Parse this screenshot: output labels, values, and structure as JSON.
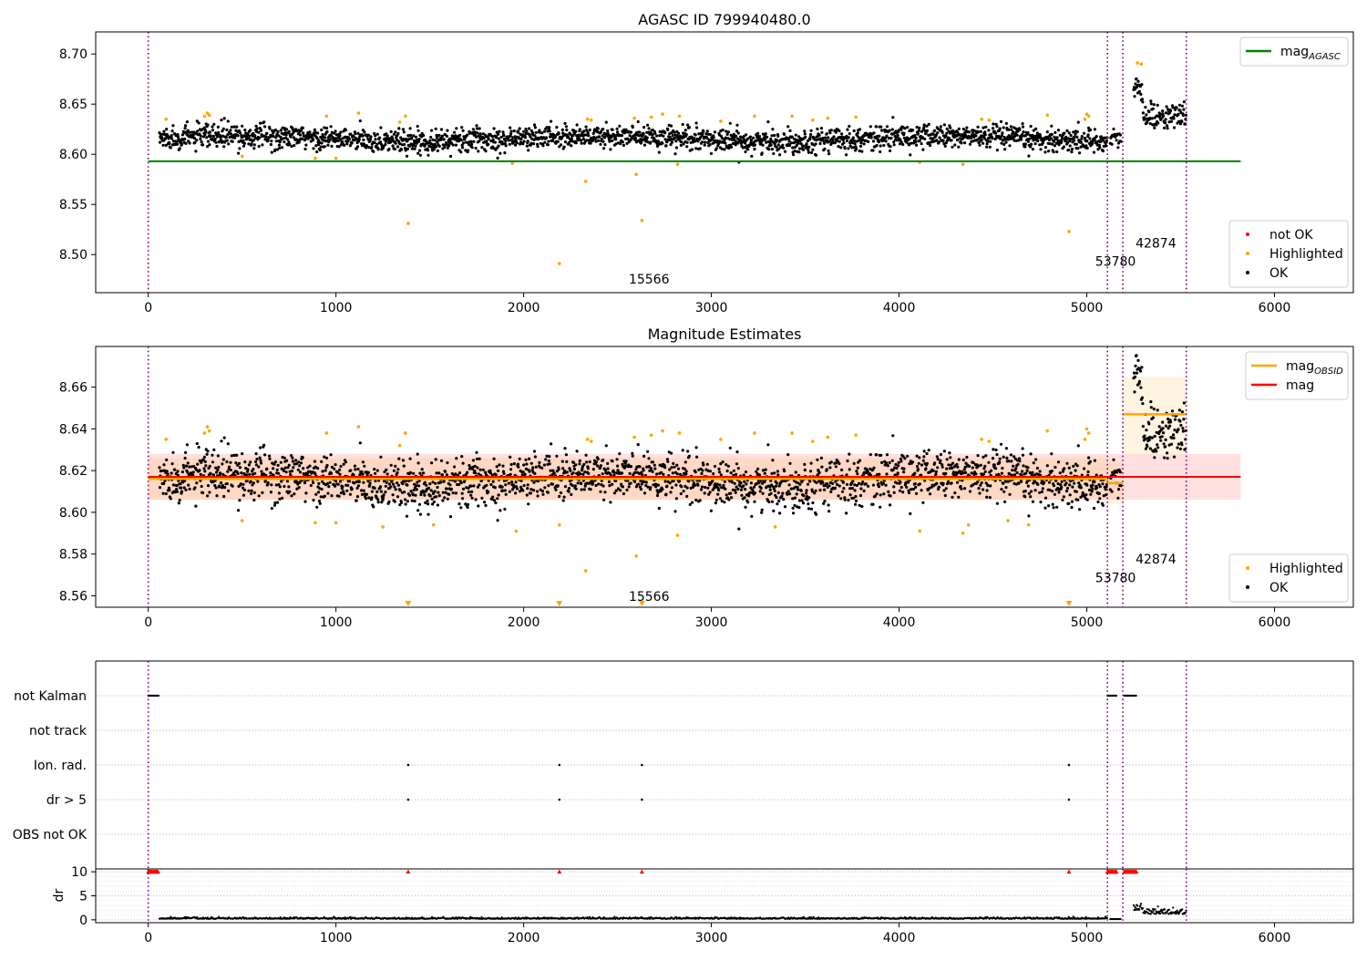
{
  "chart_data": [
    {
      "type": "scatter",
      "title": "AGASC ID 799940480.0",
      "xlim": [
        -280,
        6420
      ],
      "ylim": [
        8.462,
        8.722
      ],
      "xticks": [
        0,
        1000,
        2000,
        3000,
        4000,
        5000,
        6000
      ],
      "xtick_labels": [
        "0",
        "1000",
        "2000",
        "3000",
        "4000",
        "5000",
        "6000"
      ],
      "yticks": [
        8.5,
        8.55,
        8.6,
        8.65,
        8.7
      ],
      "ytick_labels": [
        "8.50",
        "8.55",
        "8.60",
        "8.65",
        "8.70"
      ],
      "grid": false,
      "legends": [
        {
          "placement": "top-right",
          "entries": [
            {
              "label": "mag",
              "sub": "AGASC",
              "color": "#008000",
              "kind": "line"
            }
          ]
        },
        {
          "placement": "bottom-right",
          "entries": [
            {
              "label": "not OK",
              "color": "#ff0000",
              "kind": "dot"
            },
            {
              "label": "Highlighted",
              "color": "#ffa500",
              "kind": "dot"
            },
            {
              "label": "OK",
              "color": "#000000",
              "kind": "dot"
            }
          ]
        }
      ],
      "hlines": [
        {
          "y": 8.593,
          "x0": 0,
          "x1": 5820,
          "color": "#008000"
        }
      ],
      "vlines": [
        0,
        5110,
        5192,
        5530
      ],
      "annotations": [
        {
          "text": "15566",
          "x": 2560,
          "y": 8.471
        },
        {
          "text": "53780",
          "x": 5045,
          "y": 8.489
        },
        {
          "text": "42874",
          "x": 5260,
          "y": 8.507
        }
      ],
      "highlighted": [
        [
          95,
          8.635
        ],
        [
          300,
          8.638
        ],
        [
          315,
          8.641
        ],
        [
          325,
          8.639
        ],
        [
          500,
          8.598
        ],
        [
          890,
          8.596
        ],
        [
          950,
          8.638
        ],
        [
          1000,
          8.596
        ],
        [
          1120,
          8.641
        ],
        [
          1340,
          8.632
        ],
        [
          1370,
          8.638
        ],
        [
          1385,
          8.531
        ],
        [
          1940,
          8.591
        ],
        [
          2190,
          8.491
        ],
        [
          2330,
          8.573
        ],
        [
          2340,
          8.635
        ],
        [
          2360,
          8.634
        ],
        [
          2590,
          8.636
        ],
        [
          2600,
          8.58
        ],
        [
          2630,
          8.534
        ],
        [
          2680,
          8.637
        ],
        [
          2740,
          8.64
        ],
        [
          2820,
          8.59
        ],
        [
          2830,
          8.638
        ],
        [
          3050,
          8.633
        ],
        [
          3230,
          8.638
        ],
        [
          3430,
          8.638
        ],
        [
          3540,
          8.634
        ],
        [
          3620,
          8.636
        ],
        [
          3770,
          8.637
        ],
        [
          4110,
          8.592
        ],
        [
          4340,
          8.59
        ],
        [
          4440,
          8.635
        ],
        [
          4480,
          8.634
        ],
        [
          4790,
          8.639
        ],
        [
          4905,
          8.523
        ],
        [
          4990,
          8.635
        ],
        [
          5000,
          8.64
        ],
        [
          5010,
          8.638
        ],
        [
          5270,
          8.691
        ],
        [
          5290,
          8.69
        ]
      ]
    },
    {
      "type": "scatter",
      "title": "Magnitude Estimates",
      "xlim": [
        -280,
        6420
      ],
      "ylim": [
        8.5545,
        8.6795
      ],
      "xticks": [
        0,
        1000,
        2000,
        3000,
        4000,
        5000,
        6000
      ],
      "xtick_labels": [
        "0",
        "1000",
        "2000",
        "3000",
        "4000",
        "5000",
        "6000"
      ],
      "yticks": [
        8.56,
        8.58,
        8.6,
        8.62,
        8.64,
        8.66
      ],
      "ytick_labels": [
        "8.56",
        "8.58",
        "8.60",
        "8.62",
        "8.64",
        "8.66"
      ],
      "grid": false,
      "legends": [
        {
          "placement": "top-right",
          "entries": [
            {
              "label": "mag",
              "sub": "OBSID",
              "color": "#ffa500",
              "kind": "line"
            },
            {
              "label": "mag",
              "sub": "",
              "color": "#ff0000",
              "kind": "line"
            }
          ]
        },
        {
          "placement": "bottom-right",
          "entries": [
            {
              "label": "Highlighted",
              "color": "#ffa500",
              "kind": "dot"
            },
            {
              "label": "OK",
              "color": "#000000",
              "kind": "dot"
            }
          ]
        }
      ],
      "mag": {
        "value": 8.617,
        "band": [
          8.606,
          8.628
        ],
        "x0": 0,
        "x1": 5820
      },
      "obsid_segments": [
        {
          "x0": 0,
          "x1": 5110,
          "value": 8.616,
          "band": [
            8.606,
            8.626
          ]
        },
        {
          "x0": 5110,
          "x1": 5192,
          "value": 8.614,
          "band": [
            8.604,
            8.624
          ]
        },
        {
          "x0": 5192,
          "x1": 5530,
          "value": 8.647,
          "band": [
            8.628,
            8.665
          ]
        }
      ],
      "vlines": [
        0,
        5110,
        5192,
        5530
      ],
      "annotations": [
        {
          "text": "15566",
          "x": 2560,
          "y": 8.5575
        },
        {
          "text": "53780",
          "x": 5045,
          "y": 8.5665
        },
        {
          "text": "42874",
          "x": 5260,
          "y": 8.5755
        }
      ],
      "offscale_markers": [
        1385,
        2190,
        2630,
        4905
      ],
      "highlighted": [
        [
          95,
          8.635
        ],
        [
          300,
          8.638
        ],
        [
          315,
          8.641
        ],
        [
          325,
          8.639
        ],
        [
          500,
          8.596
        ],
        [
          890,
          8.595
        ],
        [
          950,
          8.638
        ],
        [
          1000,
          8.595
        ],
        [
          1120,
          8.641
        ],
        [
          1250,
          8.593
        ],
        [
          1340,
          8.632
        ],
        [
          1370,
          8.638
        ],
        [
          1520,
          8.594
        ],
        [
          1960,
          8.591
        ],
        [
          2190,
          8.594
        ],
        [
          2330,
          8.572
        ],
        [
          2340,
          8.635
        ],
        [
          2360,
          8.634
        ],
        [
          2590,
          8.636
        ],
        [
          2600,
          8.579
        ],
        [
          2680,
          8.637
        ],
        [
          2740,
          8.639
        ],
        [
          2820,
          8.589
        ],
        [
          2830,
          8.638
        ],
        [
          3050,
          8.635
        ],
        [
          3230,
          8.638
        ],
        [
          3340,
          8.593
        ],
        [
          3430,
          8.638
        ],
        [
          3540,
          8.634
        ],
        [
          3620,
          8.636
        ],
        [
          3770,
          8.637
        ],
        [
          4110,
          8.591
        ],
        [
          4340,
          8.59
        ],
        [
          4370,
          8.594
        ],
        [
          4440,
          8.635
        ],
        [
          4480,
          8.634
        ],
        [
          4580,
          8.596
        ],
        [
          4690,
          8.594
        ],
        [
          4790,
          8.639
        ],
        [
          4990,
          8.635
        ],
        [
          5000,
          8.64
        ],
        [
          5010,
          8.638
        ]
      ]
    },
    {
      "type": "scatter",
      "title": "",
      "xlim": [
        -280,
        6420
      ],
      "categories": [
        "not Kalman",
        "not track",
        "Ion. rad.",
        "dr > 5",
        "OBS not OK"
      ],
      "vlines": [
        0,
        5110,
        5192,
        5530
      ],
      "flags": {
        "not Kalman": [
          [
            0,
            55
          ],
          [
            5110,
            5160
          ],
          [
            5200,
            5265
          ]
        ],
        "not track": [],
        "Ion. rad.": [
          1385,
          2190,
          2630,
          4905
        ],
        "dr > 5": [
          1385,
          2190,
          2630,
          4905
        ],
        "OBS not OK": []
      }
    },
    {
      "type": "scatter",
      "title": "",
      "ylabel": "dr",
      "xlim": [
        -280,
        6420
      ],
      "ylim": [
        -0.6,
        10.6
      ],
      "xticks": [
        0,
        1000,
        2000,
        3000,
        4000,
        5000,
        6000
      ],
      "xtick_labels": [
        "0",
        "1000",
        "2000",
        "3000",
        "4000",
        "5000",
        "6000"
      ],
      "yticks": [
        0,
        5,
        10
      ],
      "ytick_labels": [
        "0",
        "5",
        "10"
      ],
      "vlines": [
        0,
        5110,
        5192,
        5530
      ],
      "clipped_markers": [
        [
          0,
          55
        ],
        [
          1385
        ],
        [
          2190
        ],
        [
          2630
        ],
        [
          4905
        ],
        [
          5110,
          5160
        ],
        [
          5200,
          5265
        ]
      ]
    }
  ]
}
